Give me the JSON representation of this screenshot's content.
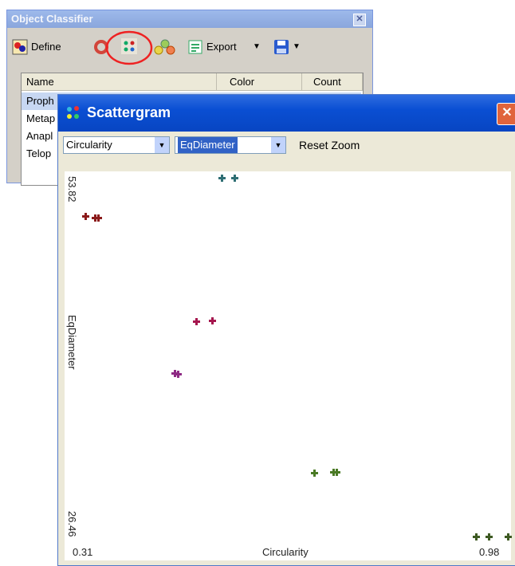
{
  "object_classifier": {
    "title": "Object Classifier",
    "toolbar": {
      "define_label": "Define",
      "export_label": "Export"
    },
    "table": {
      "columns": [
        "Name",
        "Color",
        "Count"
      ],
      "rows": [
        "Proph",
        "Metap",
        "Anapl",
        "Telop"
      ]
    }
  },
  "scattergram": {
    "title": "Scattergram",
    "x_feature": "Circularity",
    "y_feature": "EqDiameter",
    "reset_zoom_label": "Reset Zoom",
    "x_min_label": "0.31",
    "x_max_label": "0.98",
    "y_min_label": "26.46",
    "y_max_label": "53.82",
    "xlabel": "Circularity",
    "ylabel": "EqDiameter"
  },
  "chart_data": {
    "type": "scatter",
    "xlabel": "Circularity",
    "ylabel": "EqDiameter",
    "xlim": [
      0.31,
      0.98
    ],
    "ylim": [
      26.46,
      53.82
    ],
    "series": [
      {
        "color": "#2e6e73",
        "points": [
          [
            0.53,
            53.8
          ],
          [
            0.55,
            53.8
          ]
        ]
      },
      {
        "color": "#8b1a1a",
        "points": [
          [
            0.315,
            50.9
          ],
          [
            0.33,
            50.8
          ],
          [
            0.335,
            50.8
          ]
        ]
      },
      {
        "color": "#a5164e",
        "points": [
          [
            0.49,
            42.9
          ],
          [
            0.515,
            43.0
          ]
        ]
      },
      {
        "color": "#8e2a84",
        "points": [
          [
            0.455,
            39.0
          ],
          [
            0.46,
            38.9
          ]
        ]
      },
      {
        "color": "#4a7a25",
        "points": [
          [
            0.675,
            31.4
          ],
          [
            0.705,
            31.5
          ],
          [
            0.71,
            31.5
          ]
        ]
      },
      {
        "color": "#3e5a23",
        "points": [
          [
            0.93,
            26.6
          ],
          [
            0.95,
            26.6
          ],
          [
            0.98,
            26.6
          ]
        ]
      }
    ]
  }
}
